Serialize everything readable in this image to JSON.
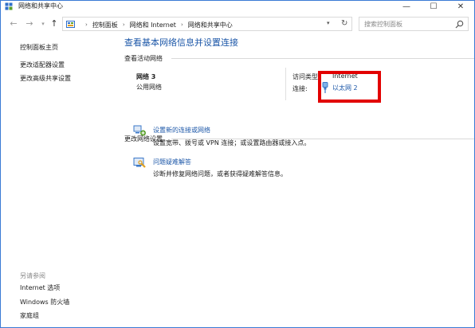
{
  "window": {
    "title": "网络和共享中心",
    "controls": {
      "minimize": "—",
      "maximize": "☐",
      "close": "✕"
    }
  },
  "address_bar": {
    "breadcrumbs": [
      "控制面板",
      "网络和 Internet",
      "网络和共享中心"
    ],
    "search_placeholder": "搜索控制面板"
  },
  "left_pane": {
    "links": [
      "控制面板主页",
      "更改适配器设置",
      "更改高级共享设置"
    ],
    "see_also_title": "另请参阅",
    "see_also": [
      "Internet 选项",
      "Windows 防火墙",
      "家庭组"
    ]
  },
  "main": {
    "page_title": "查看基本网络信息并设置连接",
    "active_networks_title": "查看活动网络",
    "network": {
      "name": "网络  3",
      "type": "公用网络",
      "access_type_label": "访问类型:",
      "access_type_value": "Internet",
      "connections_label": "连接:",
      "connection_name": "以太网 2"
    },
    "change_settings_title": "更改网络设置",
    "tasks": [
      {
        "link": "设置新的连接或网络",
        "description": "设置宽带、拨号或 VPN 连接；或设置路由器或接入点。",
        "icon": "network-setup-icon"
      },
      {
        "link": "问题疑难解答",
        "description": "诊断并修复网络问题，或者获得疑难解答信息。",
        "icon": "troubleshoot-icon"
      }
    ]
  },
  "colors": {
    "link_blue": "#1c57a8",
    "highlight_red": "#e20000",
    "window_border": "#3a7bd5"
  }
}
